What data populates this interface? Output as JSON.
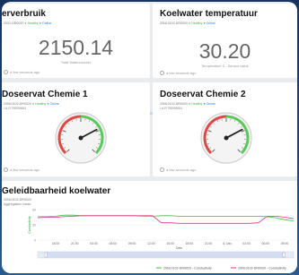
{
  "cards": {
    "verbruik": {
      "title": "erverbruik",
      "device": "2001-DR0020",
      "healthy": "Healthy",
      "online": "Online",
      "value": "2150.14",
      "caption": "Total Watercounter",
      "updated": "a few seconds ago"
    },
    "koelwater": {
      "title": "Koelwater temperatuur",
      "device": "20NL0102-DR0020",
      "healthy": "Healthy",
      "online": "Online",
      "value": "30.20",
      "caption": "Temperature 2 - Sensor value",
      "updated": "a few seconds ago"
    },
    "chemie1": {
      "title": "Doseervat Chemie 1",
      "device": "20NL0102-DR0020",
      "healthy": "Healthy",
      "online": "Online",
      "sub": "LA-FI798958651",
      "updated": "a few seconds ago"
    },
    "chemie2": {
      "title": "Doseervat Chemie 2",
      "device": "20NL0102-DR0020",
      "healthy": "Healthy",
      "online": "Online",
      "sub": "LA-FI798958651",
      "updated": "a few seconds ago"
    },
    "geleid": {
      "title": "Geleidbaarheid koelwater",
      "device": "20NL0102-DR0020",
      "aggregation": "Aggregation: mean"
    }
  },
  "gauges": {
    "chemie1": {
      "level": 0.73
    },
    "chemie2": {
      "level": 0.73
    }
  },
  "chart_data": {
    "type": "line",
    "x_ticks": [
      "18:00",
      "21:00",
      "03:00",
      "06:00",
      "09:00",
      "12:00",
      "15:00",
      "18:00",
      "21:00",
      "6. Dec",
      "03:00",
      "06:00",
      "09:00"
    ],
    "y_ticks": [
      "60",
      "30",
      "0"
    ],
    "xlabel": "Date",
    "ylabel_left": "Conductivity",
    "ylabel_left_color": "#1a9e3a",
    "ylabel_right_color": "#e0308a",
    "series": [
      {
        "name": "20NL0102-DR0020 - Conductivity",
        "color": "#48b848",
        "values": [
          46,
          46,
          47,
          49,
          49,
          48,
          48,
          48,
          48,
          48,
          48,
          48,
          47,
          47,
          48,
          48,
          47,
          47,
          47,
          47,
          47,
          47,
          47,
          47,
          47,
          47,
          46,
          44,
          40,
          38
        ]
      },
      {
        "name": "20NL0102-DR0020 - Conductivity",
        "color": "#e0308a",
        "values": [
          44,
          45,
          45,
          46,
          47,
          48,
          48,
          48,
          48,
          48,
          48,
          48,
          48,
          48,
          34,
          34,
          33,
          33,
          33,
          33,
          33,
          33,
          33,
          33,
          33,
          34,
          47,
          47,
          45,
          42
        ]
      }
    ]
  },
  "colors": {
    "healthy": "#4caf50",
    "online": "#2d7be5",
    "gauge_green": "#5ac85a",
    "gauge_red": "#e04848"
  }
}
